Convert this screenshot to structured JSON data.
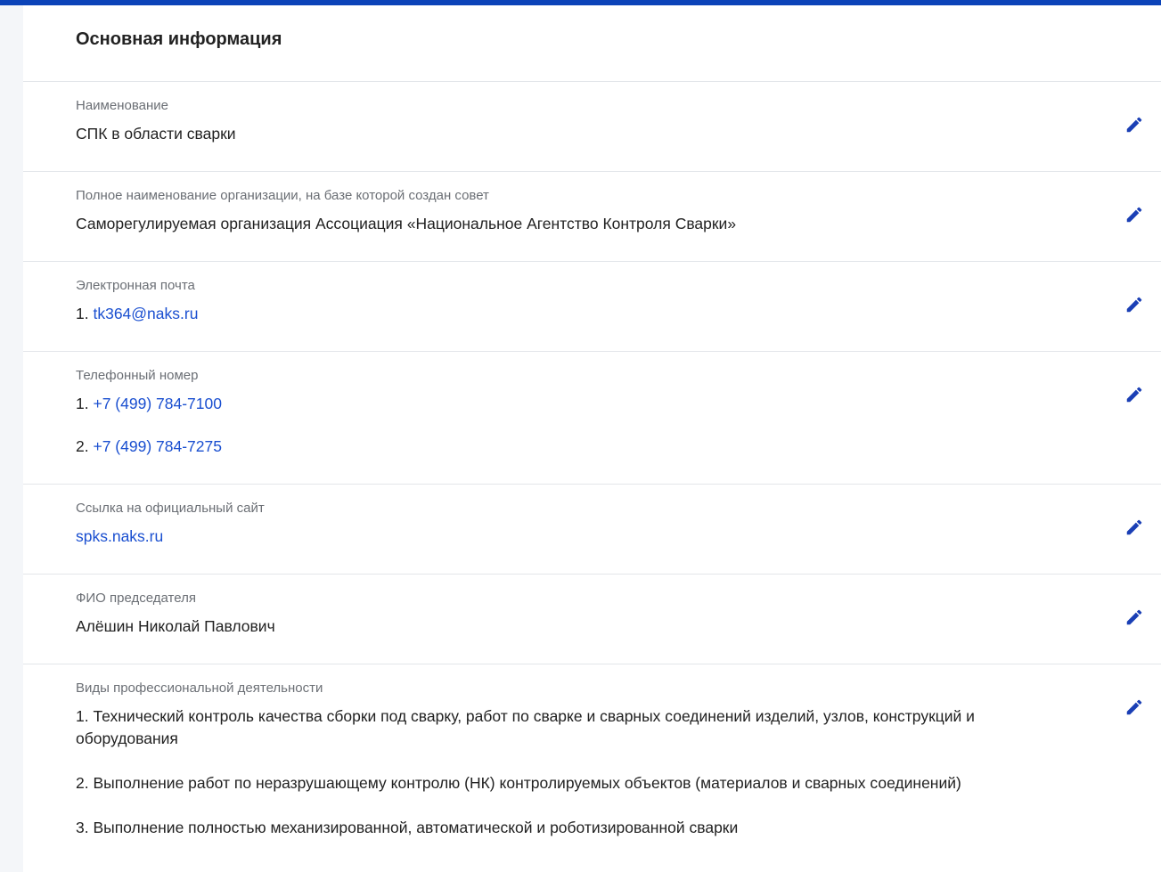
{
  "section": {
    "title": "Основная информация"
  },
  "fields": {
    "name": {
      "label": "Наименование",
      "value": "СПК в области сварки"
    },
    "full_name": {
      "label": "Полное наименование организации, на базе которой создан совет",
      "value": "Саморегулируемая организация Ассоциация «Национальное Агентство Контроля Сварки»"
    },
    "email": {
      "label": "Электронная почта",
      "items": [
        {
          "num": "1.",
          "value": "tk364@naks.ru"
        }
      ]
    },
    "phone": {
      "label": "Телефонный номер",
      "items": [
        {
          "num": "1.",
          "value": "+7 (499) 784-7100"
        },
        {
          "num": "2.",
          "value": "+7 (499) 784-7275"
        }
      ]
    },
    "site": {
      "label": "Ссылка на официальный сайт",
      "value": "spks.naks.ru"
    },
    "chairman": {
      "label": "ФИО председателя",
      "value": "Алёшин Николай Павлович"
    },
    "activities": {
      "label": "Виды профессиональной деятельности",
      "items": [
        "1. Технический контроль качества сборки под сварку, работ по сварке и сварных соединений изделий, узлов, конструкций и оборудования",
        "2. Выполнение работ по неразрушающему контролю (НК) контролируемых объектов (материалов и сварных соединений)",
        "3. Выполнение полностью механизированной, автоматической и роботизированной сварки"
      ]
    }
  },
  "colors": {
    "accent": "#0b43b8",
    "link": "#1a4fd0",
    "edit_icon": "#1a3fb5"
  },
  "icons": {
    "edit": "pencil-icon"
  }
}
